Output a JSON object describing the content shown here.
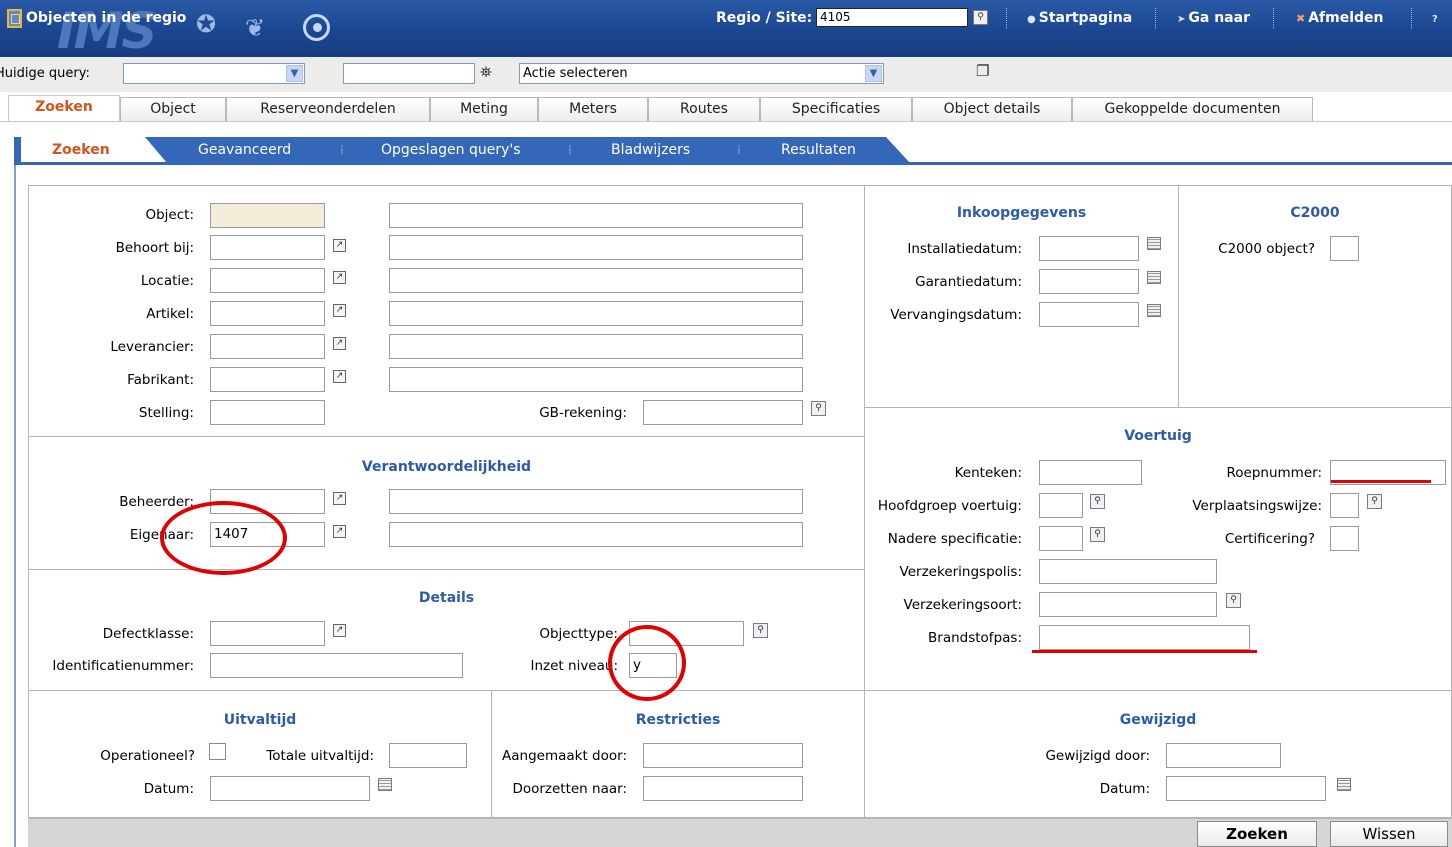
{
  "header": {
    "app_title": "Objecten in de regio",
    "logo_text": "IMS",
    "regio_label": "Regio / Site:",
    "regio_value": "4105",
    "links": [
      "Startpagina",
      "Ga naar",
      "Afmelden"
    ]
  },
  "query_bar": {
    "label": "Huidige query:",
    "query_value": "",
    "text_value": "",
    "action_select": "Actie selecteren"
  },
  "main_tabs": [
    "Zoeken",
    "Object",
    "Reserveonderdelen",
    "Meting",
    "Meters",
    "Routes",
    "Specificaties",
    "Object details",
    "Gekoppelde documenten"
  ],
  "sub_tabs": [
    "Zoeken",
    "Geavanceerd",
    "Opgeslagen query's",
    "Bladwijzers",
    "Resultaten"
  ],
  "general": {
    "object": "Object:",
    "behoort_bij": "Behoort bij:",
    "locatie": "Locatie:",
    "artikel": "Artikel:",
    "leverancier": "Leverancier:",
    "fabrikant": "Fabrikant:",
    "stelling": "Stelling:",
    "gb_rekening": "GB-rekening:"
  },
  "verantwoordelijkheid": {
    "title": "Verantwoordelijkheid",
    "beheerder": "Beheerder:",
    "eigenaar": "Eigenaar:",
    "eigenaar_value": "1407"
  },
  "details": {
    "title": "Details",
    "defectklasse": "Defectklasse:",
    "identificatienummer": "Identificatienummer:",
    "objecttype": "Objecttype:",
    "inzet_niveau": "Inzet niveau:",
    "inzet_niveau_value": "y"
  },
  "uitvaltijd": {
    "title": "Uitvaltijd",
    "operationeel": "Operationeel?",
    "totale_uitvaltijd": "Totale uitvaltijd:",
    "datum": "Datum:"
  },
  "restricties": {
    "title": "Restricties",
    "aangemaakt_door": "Aangemaakt door:",
    "doorzetten_naar": "Doorzetten naar:"
  },
  "inkoop": {
    "title": "Inkoopgegevens",
    "installatiedatum": "Installatiedatum:",
    "garantiedatum": "Garantiedatum:",
    "vervangingsdatum": "Vervangingsdatum:"
  },
  "c2000": {
    "title": "C2000",
    "object": "C2000 object?"
  },
  "voertuig": {
    "title": "Voertuig",
    "kenteken": "Kenteken:",
    "roepnummer": "Roepnummer:",
    "hoofdgroep": "Hoofdgroep voertuig:",
    "verplaatsingswijze": "Verplaatsingswijze:",
    "nadere_specificatie": "Nadere specificatie:",
    "certificering": "Certificering?",
    "verzekeringspolis": "Verzekeringspolis:",
    "verzekeringssoort": "Verzekeringsoort:",
    "brandstofpas": "Brandstofpas:"
  },
  "gewijzigd": {
    "title": "Gewijzigd",
    "gewijzigd_door": "Gewijzigd door:",
    "datum": "Datum:"
  },
  "buttons": {
    "zoeken": "Zoeken",
    "wissen": "Wissen"
  },
  "colors": {
    "header_blue": "#1b4690",
    "tab_blue": "#3567b8",
    "active_orange": "#d0541c",
    "section_blue": "#2d5ba8",
    "annotation_red": "#e00000"
  }
}
